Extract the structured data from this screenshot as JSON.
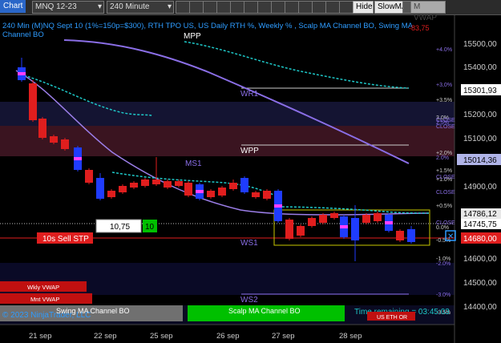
{
  "toolbar": {
    "tab_label": "Chart",
    "instrument": "MNQ 12-23",
    "interval": "240 Minute",
    "hide_label": "Hide",
    "slowma_label": "SlowMA",
    "mvwap_label": "M VWAP"
  },
  "header": {
    "line1": "240 Min (M)NQ Sept 10 (1%=150p=$300), RTH TPO US, US Daily RTH %, Weekly % , Scalp MA Channel BO, Swing MA",
    "line2": "Channel BO",
    "change": "-83,75"
  },
  "levels": {
    "mpp": "MPP",
    "wr1": "WR1",
    "wpp": "WPP",
    "ms1": "MS1",
    "ws1": "WS1",
    "ws2": "WS2"
  },
  "pct_labels": {
    "p4_0": "+4.0%",
    "p3_0w": "+3,0%",
    "p3_5": "+3.5%",
    "p3_0": "3.0%",
    "p2_5": "2.5%",
    "close1": "CLOSE",
    "close2": "CLOSE",
    "p2_0": "+2,0%",
    "p2_0b": "2.0%",
    "p1_5": "+1.5%",
    "p1_0": "+1.0%",
    "close3": "CLOSE",
    "p0_5": "+0.5%",
    "close4": "CLOSE",
    "close5": "CLOSE",
    "p0_0": "0.0%",
    "m0_5": "-0.5%",
    "m1_0": "-1.0%",
    "m2_0": "-2.0%",
    "m3_0": "-3.0%",
    "m3_5": "-3.5%"
  },
  "price_axis": {
    "ticks": [
      "15500,00",
      "15400,00",
      "15200,00",
      "15100,00",
      "14900,00",
      "14600,00",
      "14500,00",
      "14400,00"
    ],
    "badges": {
      "b15301": "15301,93",
      "b15014": "15014,36",
      "b14786": "14786,12",
      "b14745": "14745,75",
      "b14680": "14680,00"
    }
  },
  "date_axis": {
    "labels": [
      "21 sep",
      "22 sep",
      "25 sep",
      "26 sep",
      "27 sep",
      "28 sep"
    ]
  },
  "trade_panel": {
    "qty": "10,75",
    "qty2": "10",
    "sell_stop": "10s  Sell STP"
  },
  "bottom": {
    "wkly_vwap": "Wkly VWAP",
    "mnt_vwap": "Mnt VWAP",
    "copyright": "© 2023 NinjaTrader, LLC",
    "swing": "Swing MA Channel BO",
    "scalp": "Scalp MA Channel BO",
    "time_remaining": "Time remaining = 03:45:03",
    "us_eth": "US ETH OR"
  },
  "colors": {
    "bull": "#1f3cff",
    "bear": "#e01e1e",
    "cyan": "#1ec8c8",
    "purple": "#8a6ee6",
    "scalp_green": "#00c000",
    "swing_grey": "#707070"
  }
}
